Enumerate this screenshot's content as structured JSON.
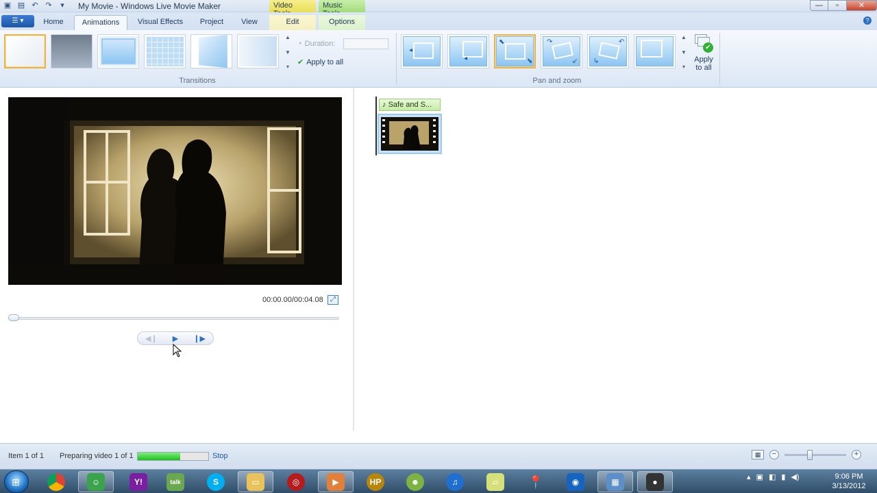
{
  "window": {
    "title": "My Movie - Windows Live Movie Maker",
    "context_tabs": {
      "video_tools": "Video Tools",
      "music_tools": "Music Tools"
    }
  },
  "tabs": [
    {
      "label": "Home"
    },
    {
      "label": "Animations",
      "active": true
    },
    {
      "label": "Visual Effects"
    },
    {
      "label": "Project"
    },
    {
      "label": "View"
    },
    {
      "label": "Edit"
    },
    {
      "label": "Options"
    }
  ],
  "ribbon": {
    "transitions": {
      "group_label": "Transitions",
      "duration_label": "Duration:",
      "duration_value": "",
      "apply_all_label": "Apply to all"
    },
    "pan_zoom": {
      "group_label": "Pan and zoom",
      "selected_index": 2,
      "apply_all_line1": "Apply",
      "apply_all_line2": "to all"
    }
  },
  "preview": {
    "timecode": "00:00.00/00:04.08"
  },
  "storyboard": {
    "music_clip_label": "Safe and S..."
  },
  "status": {
    "item_text": "Item 1 of 1",
    "preparing_text": "Preparing video 1 of 1",
    "progress": 0.6,
    "stop_label": "Stop"
  },
  "zoom": {
    "level": 0.4
  },
  "clock": {
    "time": "9:06 PM",
    "date": "3/13/2012"
  },
  "colors": {
    "accent": "#1e395b",
    "ribbon_bg": "#dce7f5",
    "progress": "#1fbf1f"
  }
}
